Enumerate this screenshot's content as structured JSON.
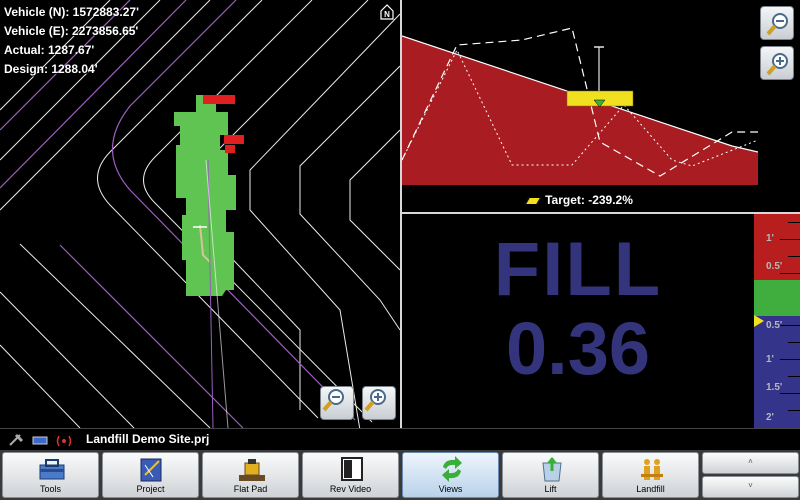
{
  "readouts": {
    "vehicle_n": "Vehicle (N): 1572883.27'",
    "vehicle_e": "Vehicle (E): 2273856.65'",
    "actual": "Actual: 1287.67'",
    "design": "Design: 1288.04'"
  },
  "profile": {
    "target_label": "Target: -239.2%"
  },
  "cut_fill": {
    "mode": "FILL",
    "value": "0.36"
  },
  "grade_scale": {
    "labels": [
      "1'",
      "0.5'",
      "0.5'",
      "1'",
      "1.5'",
      "2'"
    ],
    "indicator_fraction": 0.5,
    "colors": {
      "fill_zone": "#b81e1e",
      "on_grade": "#3fae3f",
      "cut_zone": "#34348a",
      "indicator": "#f0e020"
    }
  },
  "status": {
    "project_file": "Landfill Demo Site.prj"
  },
  "toolbar": {
    "buttons": [
      {
        "label": "Tools",
        "icon": "toolbox-icon"
      },
      {
        "label": "Project",
        "icon": "project-icon"
      },
      {
        "label": "Flat Pad",
        "icon": "dozer-icon"
      },
      {
        "label": "Rev Video",
        "icon": "video-icon"
      },
      {
        "label": "Views",
        "icon": "refresh-arrows-icon",
        "active": true
      },
      {
        "label": "Lift",
        "icon": "bin-icon"
      },
      {
        "label": "Landfill",
        "icon": "crowd-icon"
      }
    ],
    "scroll_up": "˄",
    "scroll_down": "˅"
  },
  "colors": {
    "profile_fill": "#a81c22",
    "coverage_green": "#5fc452",
    "contour_line": "#b07ac8",
    "zoom_button": "#c9ced4"
  }
}
